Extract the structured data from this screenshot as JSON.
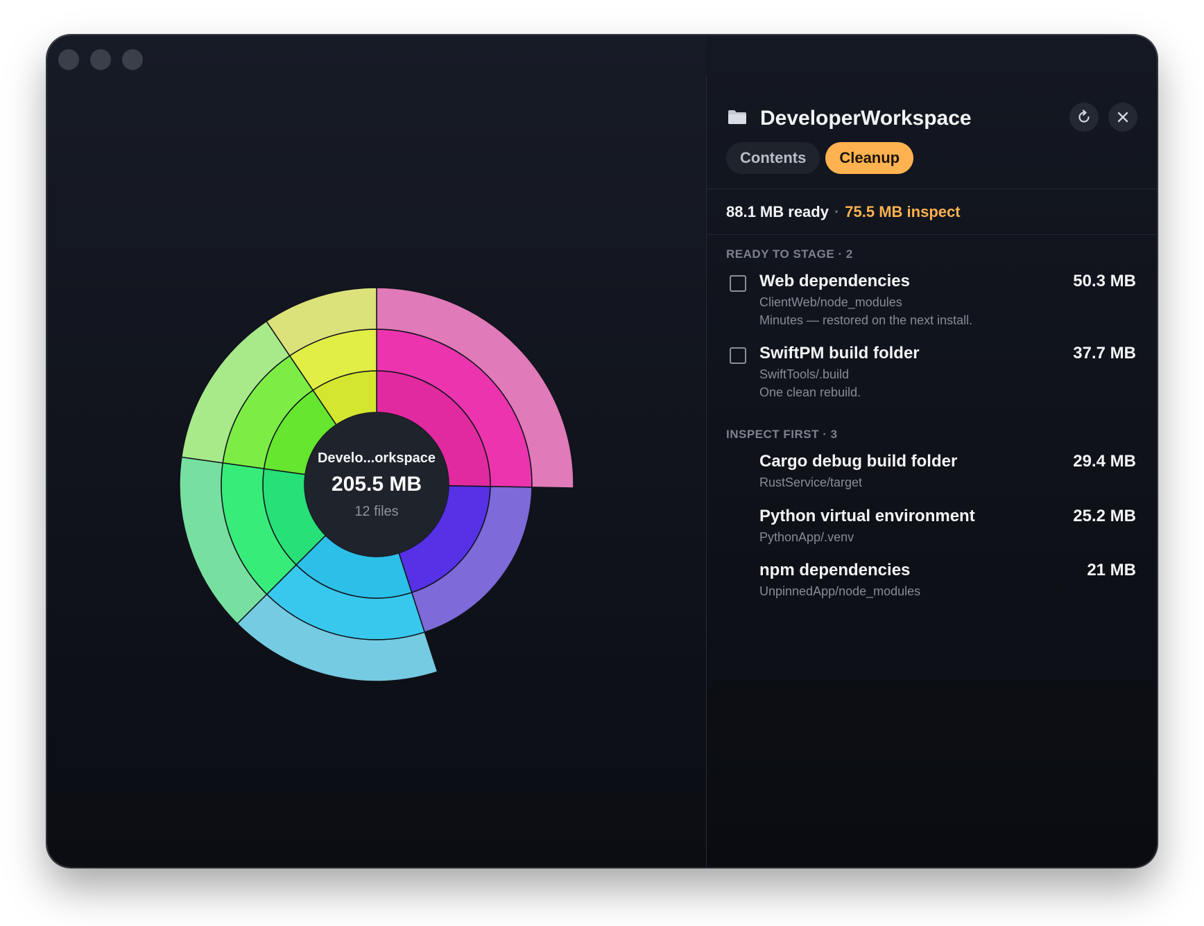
{
  "window": {
    "traffic_lights": [
      "close",
      "minimize",
      "zoom"
    ]
  },
  "chart": {
    "center": {
      "name": "Develo...orkspace",
      "size": "205.5 MB",
      "files": "12 files"
    },
    "chart_data": {
      "type": "sunburst",
      "rings": 3,
      "segments": [
        {
          "color": "#e0267f",
          "ring_colors": [
            "#e12aa0",
            "#ec34ae",
            "#e07ab8"
          ],
          "start_deg": 0,
          "end_deg": 91,
          "depth": 3
        },
        {
          "color": "#5530e8",
          "ring_colors": [
            "#5631e6",
            "#7e6ad8"
          ],
          "start_deg": 91,
          "end_deg": 162,
          "depth": 2
        },
        {
          "color": "#2ec2e6",
          "ring_colors": [
            "#2cc0e8",
            "#38c8ee",
            "#75cbe2"
          ],
          "start_deg": 162,
          "end_deg": 225,
          "depth": 3
        },
        {
          "color": "#27e07a",
          "ring_colors": [
            "#27e077",
            "#38ec7a",
            "#77e0a0"
          ],
          "start_deg": 225,
          "end_deg": 278,
          "depth": 3
        },
        {
          "color": "#64e62c",
          "ring_colors": [
            "#66e62e",
            "#7ded46",
            "#a8e98a"
          ],
          "start_deg": 278,
          "end_deg": 326,
          "depth": 3
        },
        {
          "color": "#d3e62c",
          "ring_colors": [
            "#d5e630",
            "#e0ee46",
            "#dce27a"
          ],
          "start_deg": 326,
          "end_deg": 360,
          "depth": 3
        }
      ]
    }
  },
  "panel": {
    "title": "DeveloperWorkspace",
    "folder_icon": "folder-icon",
    "refresh_icon": "refresh-icon",
    "close_icon": "close-icon",
    "tabs": [
      {
        "label": "Contents",
        "active": false
      },
      {
        "label": "Cleanup",
        "active": true
      }
    ],
    "summary": {
      "ready": "88.1 MB ready",
      "separator": "·",
      "inspect": "75.5 MB inspect"
    },
    "sections": [
      {
        "label": "READY TO STAGE · 2",
        "items": [
          {
            "title": "Web dependencies",
            "size": "50.3 MB",
            "path": "ClientWeb/node_modules",
            "note": "Minutes — restored on the next install.",
            "checked": false
          },
          {
            "title": "SwiftPM build folder",
            "size": "37.7 MB",
            "path": "SwiftTools/.build",
            "note": "One clean rebuild.",
            "checked": false
          }
        ]
      },
      {
        "label": "INSPECT FIRST · 3",
        "items": [
          {
            "title": "Cargo debug build folder",
            "size": "29.4 MB",
            "path": "RustService/target"
          },
          {
            "title": "Python virtual environment",
            "size": "25.2 MB",
            "path": "PythonApp/.venv"
          },
          {
            "title": "npm dependencies",
            "size": "21 MB",
            "path": "UnpinnedApp/node_modules"
          }
        ]
      }
    ],
    "colors": {
      "accent": "#ffb24f",
      "background": "#141822",
      "text": "#f3f4f6",
      "muted": "#878c95"
    }
  }
}
